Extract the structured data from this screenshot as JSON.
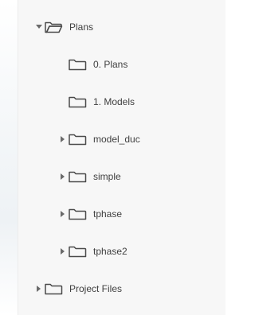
{
  "tree": {
    "items": [
      {
        "label": "Plans",
        "state": "expanded",
        "icon": "folder-open-icon"
      },
      {
        "label": "0. Plans",
        "state": "leaf",
        "icon": "folder-icon"
      },
      {
        "label": "1. Models",
        "state": "leaf",
        "icon": "folder-icon"
      },
      {
        "label": "model_duc",
        "state": "collapsed",
        "icon": "folder-icon"
      },
      {
        "label": "simple",
        "state": "collapsed",
        "icon": "folder-icon"
      },
      {
        "label": "tphase",
        "state": "collapsed",
        "icon": "folder-icon"
      },
      {
        "label": "tphase2",
        "state": "collapsed",
        "icon": "folder-icon"
      },
      {
        "label": "Project Files",
        "state": "collapsed",
        "icon": "folder-icon"
      }
    ]
  },
  "colors": {
    "panel_background": "#f7f7f7",
    "text": "#3f3f3f",
    "icon": "#4a4a4a",
    "caret": "#6a6a6a"
  }
}
